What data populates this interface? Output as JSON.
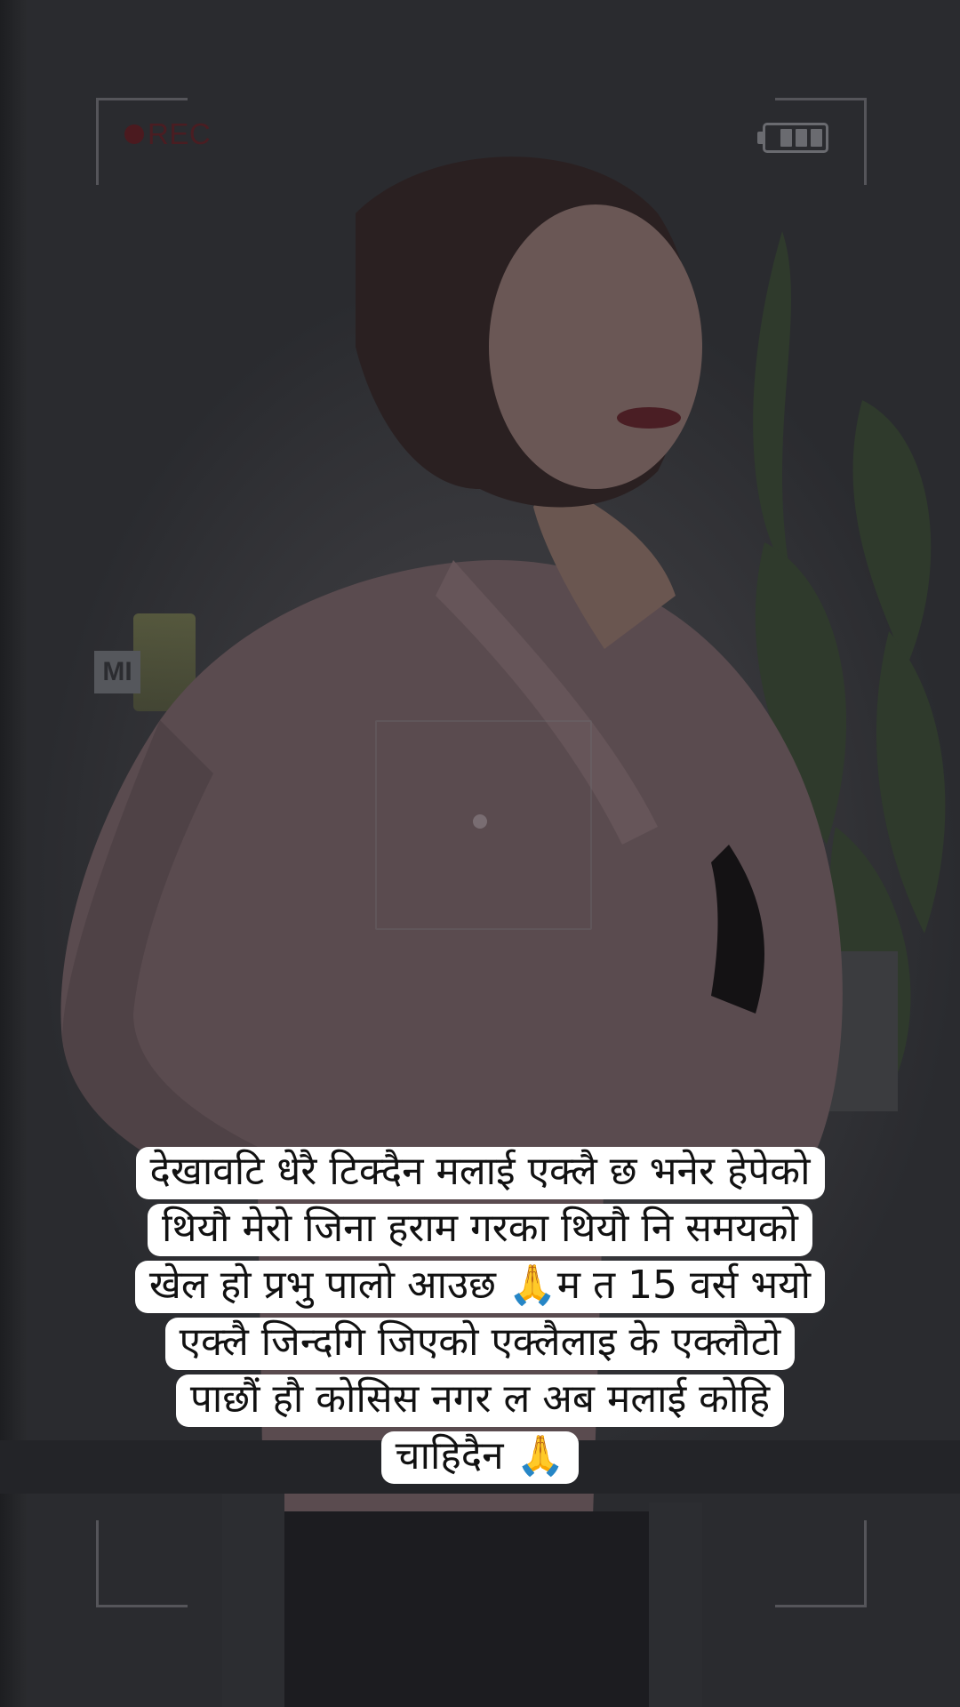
{
  "overlay": {
    "rec_label": "REC",
    "battery_level": 0.75
  },
  "wall_sign_text": "MI",
  "caption": {
    "lines": [
      "देखावटि धेरै टिक्दैन मलाई एक्लै छ भनेर हेपेको",
      "थियौ मेरो जिना हराम गरका थियौ नि समयको",
      "खेल हो प्रभु पालो आउछ 🙏म त 15  वर्स भयो",
      "एक्लै जिन्दगि जिएको एक्लैलाइ के एक्लौटो",
      "पाछौं हौ कोसिस  नगर ल अब मलाई कोहि",
      "चाहिदैन 🙏"
    ]
  },
  "colors": {
    "caption_bg": "#ffffff",
    "caption_text": "#111111",
    "rec_red": "#4b1a1f",
    "overlay_gray": "#6a6b70"
  }
}
